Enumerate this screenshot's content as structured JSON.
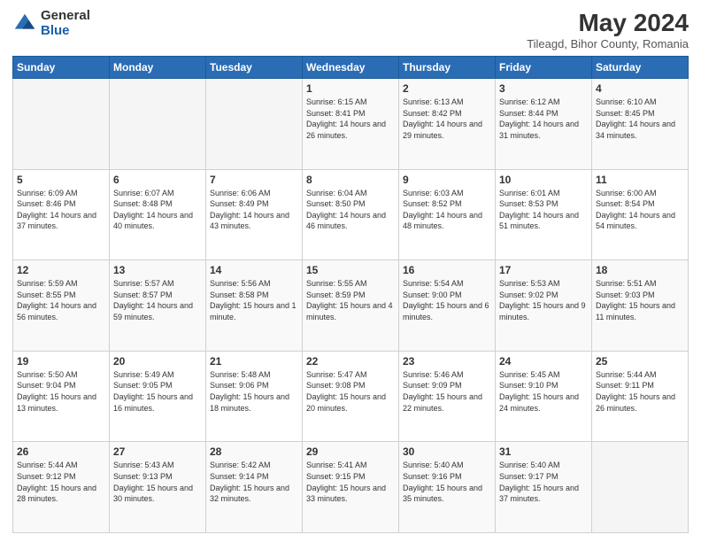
{
  "logo": {
    "general": "General",
    "blue": "Blue"
  },
  "title": "May 2024",
  "subtitle": "Tileagd, Bihor County, Romania",
  "days_header": [
    "Sunday",
    "Monday",
    "Tuesday",
    "Wednesday",
    "Thursday",
    "Friday",
    "Saturday"
  ],
  "weeks": [
    [
      {
        "day": "",
        "info": ""
      },
      {
        "day": "",
        "info": ""
      },
      {
        "day": "",
        "info": ""
      },
      {
        "day": "1",
        "info": "Sunrise: 6:15 AM\nSunset: 8:41 PM\nDaylight: 14 hours and 26 minutes."
      },
      {
        "day": "2",
        "info": "Sunrise: 6:13 AM\nSunset: 8:42 PM\nDaylight: 14 hours and 29 minutes."
      },
      {
        "day": "3",
        "info": "Sunrise: 6:12 AM\nSunset: 8:44 PM\nDaylight: 14 hours and 31 minutes."
      },
      {
        "day": "4",
        "info": "Sunrise: 6:10 AM\nSunset: 8:45 PM\nDaylight: 14 hours and 34 minutes."
      }
    ],
    [
      {
        "day": "5",
        "info": "Sunrise: 6:09 AM\nSunset: 8:46 PM\nDaylight: 14 hours and 37 minutes."
      },
      {
        "day": "6",
        "info": "Sunrise: 6:07 AM\nSunset: 8:48 PM\nDaylight: 14 hours and 40 minutes."
      },
      {
        "day": "7",
        "info": "Sunrise: 6:06 AM\nSunset: 8:49 PM\nDaylight: 14 hours and 43 minutes."
      },
      {
        "day": "8",
        "info": "Sunrise: 6:04 AM\nSunset: 8:50 PM\nDaylight: 14 hours and 46 minutes."
      },
      {
        "day": "9",
        "info": "Sunrise: 6:03 AM\nSunset: 8:52 PM\nDaylight: 14 hours and 48 minutes."
      },
      {
        "day": "10",
        "info": "Sunrise: 6:01 AM\nSunset: 8:53 PM\nDaylight: 14 hours and 51 minutes."
      },
      {
        "day": "11",
        "info": "Sunrise: 6:00 AM\nSunset: 8:54 PM\nDaylight: 14 hours and 54 minutes."
      }
    ],
    [
      {
        "day": "12",
        "info": "Sunrise: 5:59 AM\nSunset: 8:55 PM\nDaylight: 14 hours and 56 minutes."
      },
      {
        "day": "13",
        "info": "Sunrise: 5:57 AM\nSunset: 8:57 PM\nDaylight: 14 hours and 59 minutes."
      },
      {
        "day": "14",
        "info": "Sunrise: 5:56 AM\nSunset: 8:58 PM\nDaylight: 15 hours and 1 minute."
      },
      {
        "day": "15",
        "info": "Sunrise: 5:55 AM\nSunset: 8:59 PM\nDaylight: 15 hours and 4 minutes."
      },
      {
        "day": "16",
        "info": "Sunrise: 5:54 AM\nSunset: 9:00 PM\nDaylight: 15 hours and 6 minutes."
      },
      {
        "day": "17",
        "info": "Sunrise: 5:53 AM\nSunset: 9:02 PM\nDaylight: 15 hours and 9 minutes."
      },
      {
        "day": "18",
        "info": "Sunrise: 5:51 AM\nSunset: 9:03 PM\nDaylight: 15 hours and 11 minutes."
      }
    ],
    [
      {
        "day": "19",
        "info": "Sunrise: 5:50 AM\nSunset: 9:04 PM\nDaylight: 15 hours and 13 minutes."
      },
      {
        "day": "20",
        "info": "Sunrise: 5:49 AM\nSunset: 9:05 PM\nDaylight: 15 hours and 16 minutes."
      },
      {
        "day": "21",
        "info": "Sunrise: 5:48 AM\nSunset: 9:06 PM\nDaylight: 15 hours and 18 minutes."
      },
      {
        "day": "22",
        "info": "Sunrise: 5:47 AM\nSunset: 9:08 PM\nDaylight: 15 hours and 20 minutes."
      },
      {
        "day": "23",
        "info": "Sunrise: 5:46 AM\nSunset: 9:09 PM\nDaylight: 15 hours and 22 minutes."
      },
      {
        "day": "24",
        "info": "Sunrise: 5:45 AM\nSunset: 9:10 PM\nDaylight: 15 hours and 24 minutes."
      },
      {
        "day": "25",
        "info": "Sunrise: 5:44 AM\nSunset: 9:11 PM\nDaylight: 15 hours and 26 minutes."
      }
    ],
    [
      {
        "day": "26",
        "info": "Sunrise: 5:44 AM\nSunset: 9:12 PM\nDaylight: 15 hours and 28 minutes."
      },
      {
        "day": "27",
        "info": "Sunrise: 5:43 AM\nSunset: 9:13 PM\nDaylight: 15 hours and 30 minutes."
      },
      {
        "day": "28",
        "info": "Sunrise: 5:42 AM\nSunset: 9:14 PM\nDaylight: 15 hours and 32 minutes."
      },
      {
        "day": "29",
        "info": "Sunrise: 5:41 AM\nSunset: 9:15 PM\nDaylight: 15 hours and 33 minutes."
      },
      {
        "day": "30",
        "info": "Sunrise: 5:40 AM\nSunset: 9:16 PM\nDaylight: 15 hours and 35 minutes."
      },
      {
        "day": "31",
        "info": "Sunrise: 5:40 AM\nSunset: 9:17 PM\nDaylight: 15 hours and 37 minutes."
      },
      {
        "day": "",
        "info": ""
      }
    ]
  ]
}
